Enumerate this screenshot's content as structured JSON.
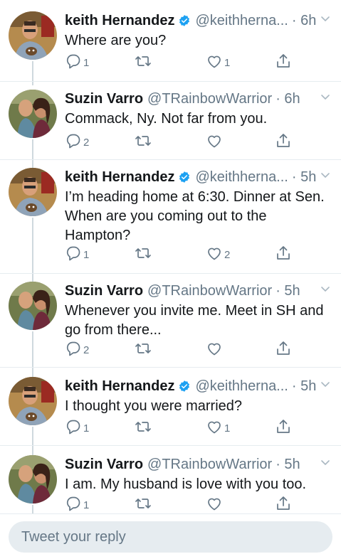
{
  "tweets": [
    {
      "name": "keith Hernandez",
      "verified": true,
      "handle": "@keithherna...",
      "time": "· 6h",
      "text": "Where are you?",
      "replies": "1",
      "likes": "1",
      "avatar": "keith"
    },
    {
      "name": "Suzin Varro",
      "verified": false,
      "handle": "@TRainbowWarrior",
      "time": "· 6h",
      "text": "Commack, Ny.  Not far from you.",
      "replies": "2",
      "likes": "",
      "avatar": "suzin"
    },
    {
      "name": "keith Hernandez",
      "verified": true,
      "handle": "@keithherna...",
      "time": "· 5h",
      "text": "I’m heading home at 6:30. Dinner at Sen. When are you coming out to the Hampton?",
      "replies": "1",
      "likes": "2",
      "avatar": "keith"
    },
    {
      "name": "Suzin Varro",
      "verified": false,
      "handle": "@TRainbowWarrior",
      "time": "· 5h",
      "text": "Whenever you invite me. Meet in SH and go from there...",
      "replies": "2",
      "likes": "",
      "avatar": "suzin"
    },
    {
      "name": "keith Hernandez",
      "verified": true,
      "handle": "@keithherna...",
      "time": "· 5h",
      "text": "I thought you were married?",
      "replies": "1",
      "likes": "1",
      "avatar": "keith"
    },
    {
      "name": "Suzin Varro",
      "verified": false,
      "handle": "@TRainbowWarrior",
      "time": "· 5h",
      "text": "I am. My husband is love with you too.",
      "replies": "1",
      "likes": "",
      "avatar": "suzin"
    }
  ],
  "reply_box": {
    "placeholder": "Tweet your reply"
  },
  "colors": {
    "verified": "#1da1f2",
    "secondary_text": "#657786",
    "divider": "#e6ecf0"
  },
  "icons": [
    "reply-icon",
    "retweet-icon",
    "like-icon",
    "share-icon",
    "verified-badge-icon",
    "chevron-down-icon"
  ]
}
